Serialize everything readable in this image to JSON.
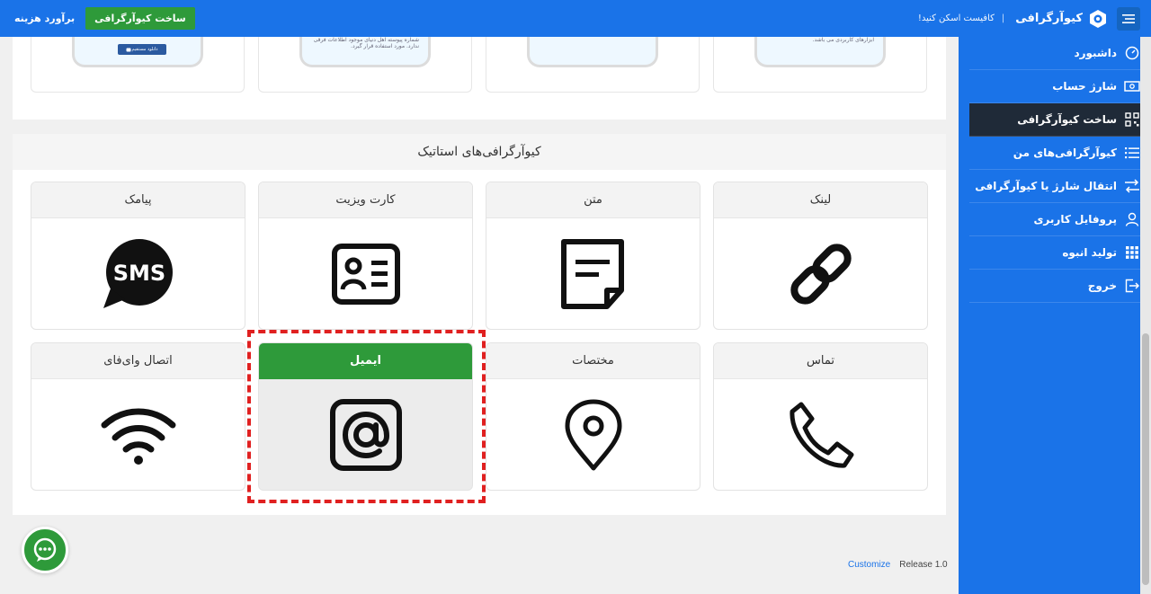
{
  "topbar": {
    "brand": "کیوآرگرافی",
    "slogan": "کافیست اسکن کنید!",
    "build_button": "ساخت کیوآرگرافی",
    "estimate_button": "برآورد هزینه"
  },
  "sidebar": {
    "items": [
      {
        "label": "داشبورد",
        "icon": "dashboard-icon"
      },
      {
        "label": "شارژ حساب",
        "icon": "wallet-icon"
      },
      {
        "label": "ساخت کیوآرگرافی",
        "icon": "qr-icon",
        "active": true
      },
      {
        "label": "کیوآرگرافی‌های من",
        "icon": "list-icon"
      },
      {
        "label": "انتقال شارژ یا کیوآرگرافی",
        "icon": "transfer-icon"
      },
      {
        "label": "پروفایل کاربری",
        "icon": "user-icon"
      },
      {
        "label": "تولید انبوه",
        "icon": "grid-icon"
      },
      {
        "label": "خروج",
        "icon": "logout-icon"
      }
    ]
  },
  "previews": {
    "card1_text": "ابزارهای کاربردی می باشد.",
    "card3_text": "شماره پیوسته اهل دنیای موجود اطلاعات فرقی ندارد. مورد استفاده قرار گیرد.",
    "card4_button": "دانلود مستقیم"
  },
  "static_section": {
    "title": "کیوآرگرافی‌های استاتیک",
    "cards": [
      {
        "label": "لینک",
        "icon": "link-icon"
      },
      {
        "label": "متن",
        "icon": "text-document-icon"
      },
      {
        "label": "کارت ویزیت",
        "icon": "business-card-icon"
      },
      {
        "label": "پیامک",
        "icon": "sms-icon"
      },
      {
        "label": "تماس",
        "icon": "phone-icon"
      },
      {
        "label": "مختصات",
        "icon": "location-pin-icon"
      },
      {
        "label": "ایمیل",
        "icon": "email-at-icon",
        "selected": true
      },
      {
        "label": "اتصال وای‌فای",
        "icon": "wifi-icon"
      }
    ],
    "sms_glyph": "SMS"
  },
  "footer": {
    "customize": "Customize",
    "release": "Release 1.0"
  },
  "colors": {
    "primary": "#1a73e8",
    "green": "#2e9a3a",
    "sidebar_active": "#1f2a38",
    "highlight": "#e02020"
  }
}
